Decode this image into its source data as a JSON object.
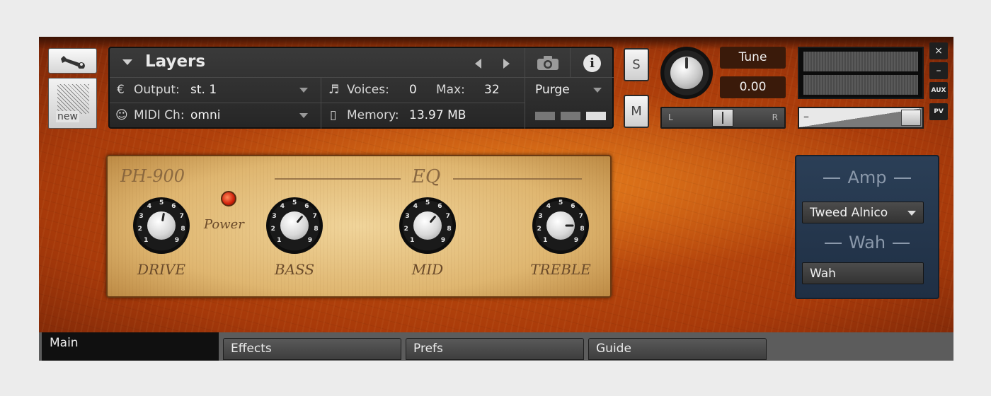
{
  "header": {
    "instrument_title": "Layers",
    "output_label": "Output:",
    "output_value": "st. 1",
    "midi_label": "MIDI Ch:",
    "midi_value": "omni",
    "voices_label": "Voices:",
    "voices_value": "0",
    "max_label": "Max:",
    "max_value": "32",
    "memory_label": "Memory:",
    "memory_value": "13.97 MB",
    "purge_label": "Purge",
    "new_label": "new",
    "solo_label": "S",
    "mute_label": "M"
  },
  "tune": {
    "label": "Tune",
    "value": "0.00",
    "pan_left": "L",
    "pan_right": "R"
  },
  "side_buttons": {
    "close": "×",
    "minimize": "–",
    "aux": "AUX",
    "pv": "PV"
  },
  "amp_panel": {
    "model": "PH-900",
    "eq_label": "EQ",
    "power_label": "Power",
    "knobs": [
      {
        "label": "DRIVE"
      },
      {
        "label": "BASS"
      },
      {
        "label": "MID"
      },
      {
        "label": "TREBLE"
      }
    ],
    "scale": [
      "1",
      "2",
      "3",
      "4",
      "5",
      "6",
      "7",
      "8",
      "9"
    ]
  },
  "fx_panel": {
    "amp_heading": "Amp",
    "amp_value": "Tweed Alnico",
    "wah_heading": "Wah",
    "wah_value": "Wah"
  },
  "tabs": [
    {
      "label": "Main"
    },
    {
      "label": "Effects"
    },
    {
      "label": "Prefs"
    },
    {
      "label": "Guide"
    }
  ]
}
